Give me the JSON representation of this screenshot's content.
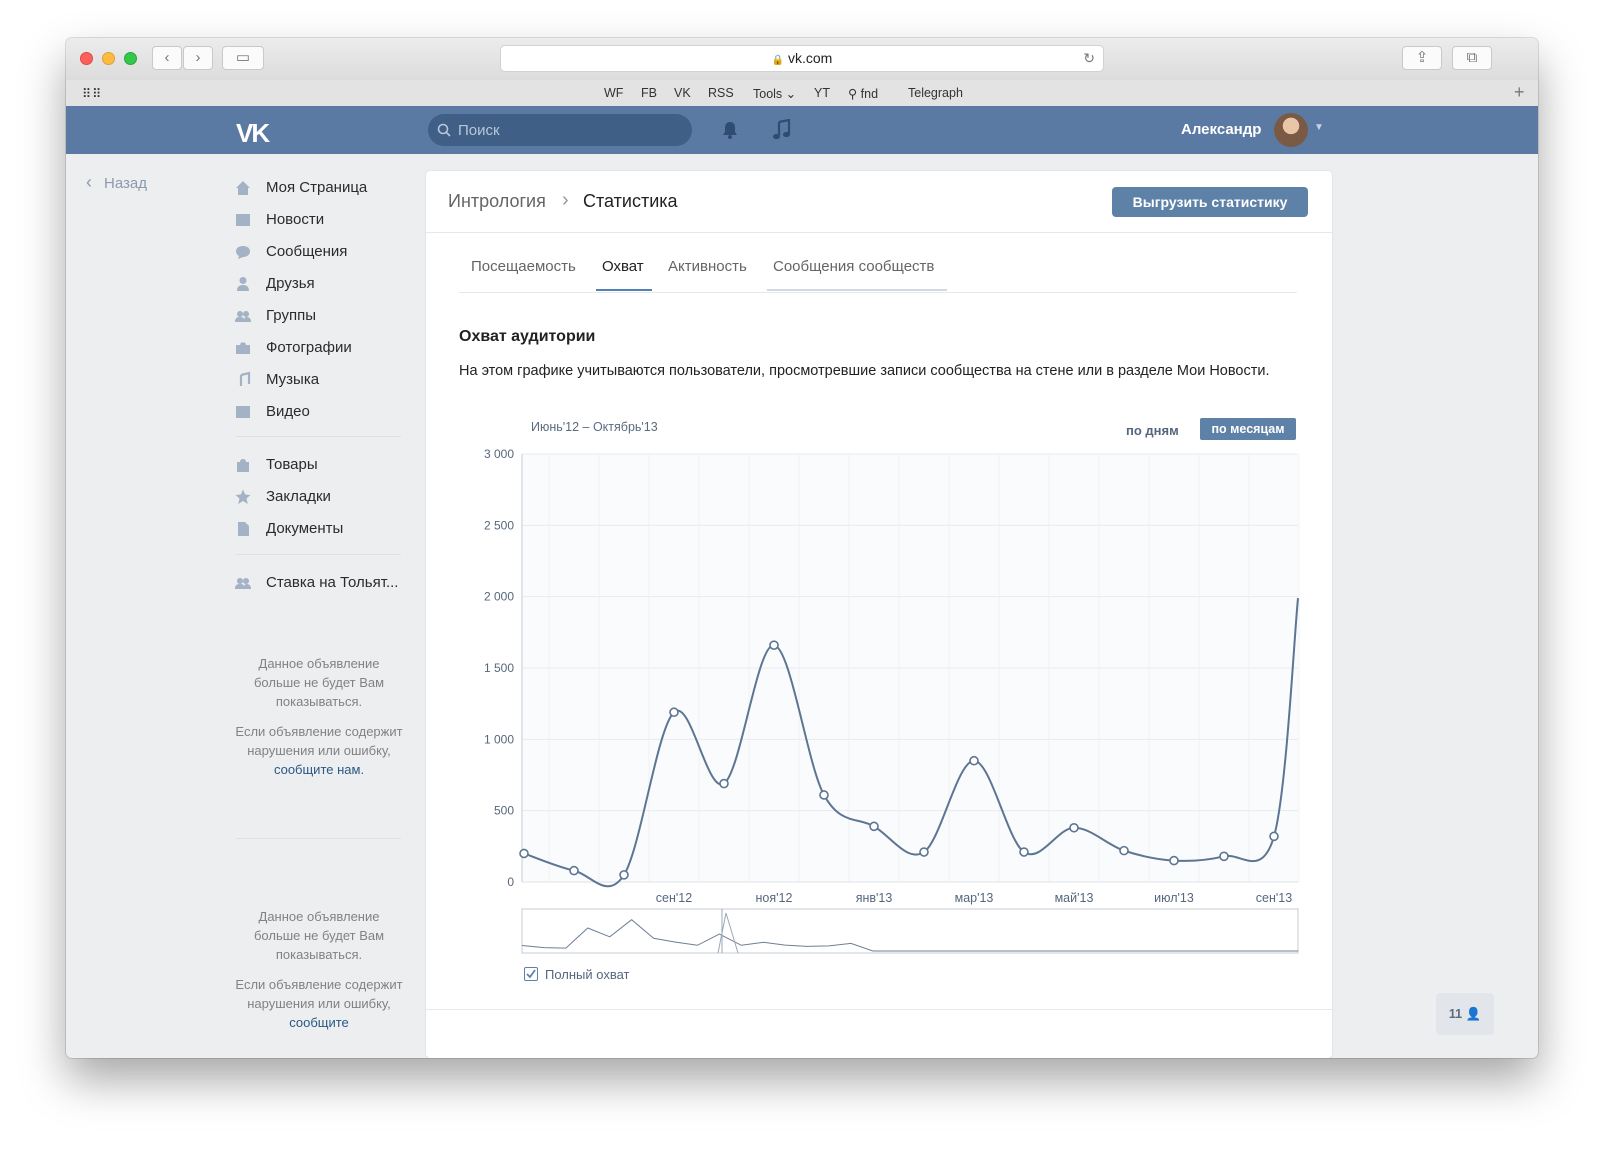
{
  "browser": {
    "url": "vk.com",
    "favorites": [
      "WF",
      "FB",
      "VK",
      "RSS",
      "Tools",
      "YT",
      "fnd",
      "Telegraph"
    ]
  },
  "header": {
    "logo": "VK",
    "search_placeholder": "Поиск",
    "user_name": "Александр"
  },
  "sidebar": {
    "back": "Назад",
    "items": [
      {
        "label": "Моя Страница",
        "icon": "home-icon"
      },
      {
        "label": "Новости",
        "icon": "news-icon"
      },
      {
        "label": "Сообщения",
        "icon": "messages-icon"
      },
      {
        "label": "Друзья",
        "icon": "friend-icon"
      },
      {
        "label": "Группы",
        "icon": "groups-icon"
      },
      {
        "label": "Фотографии",
        "icon": "camera-icon"
      },
      {
        "label": "Музыка",
        "icon": "music-icon"
      },
      {
        "label": "Видео",
        "icon": "video-icon"
      },
      {
        "label": "Товары",
        "icon": "bag-icon"
      },
      {
        "label": "Закладки",
        "icon": "star-icon"
      },
      {
        "label": "Документы",
        "icon": "document-icon"
      },
      {
        "label": "Ставка на Тольят...",
        "icon": "groups-icon"
      }
    ],
    "ads": [
      {
        "line1": "Данное объявление больше не будет Вам показываться.",
        "line2": "Если объявление содержит нарушения или ошибку,",
        "link": "сообщите нам."
      },
      {
        "line1": "Данное объявление больше не будет Вам показываться.",
        "line2": "Если объявление содержит нарушения или ошибку,",
        "link": "сообщите"
      }
    ]
  },
  "page": {
    "breadcrumb_parent": "Интрология",
    "breadcrumb_current": "Статистика",
    "export_button": "Выгрузить статистику",
    "tabs": [
      "Посещаемость",
      "Охват",
      "Активность",
      "Сообщения сообществ"
    ],
    "active_tab": "Охват",
    "section_title": "Охват аудитории",
    "description": "На этом графике учитываются пользователи, просмотревшие записи сообщества на стене или в разделе Мои Новости.",
    "period": "Июнь'12 – Октябрь'13",
    "by_day": "по дням",
    "by_month": "по месяцам",
    "legend_label": "Полный охват",
    "online_counter": "11"
  },
  "colors": {
    "accent": "#5a7aa3",
    "line": "#5d7593",
    "button": "#5e81a8"
  },
  "chart_data": {
    "type": "line",
    "x": [
      "июн'12",
      "июл'12",
      "авг'12",
      "сен'12",
      "окт'12",
      "ноя'12",
      "дек'12",
      "янв'13",
      "фев'13",
      "мар'13",
      "апр'13",
      "май'13",
      "июн'13",
      "июл'13",
      "авг'13",
      "сен'13"
    ],
    "series": [
      {
        "values": [
          200,
          80,
          50,
          1190,
          690,
          1660,
          610,
          390,
          210,
          850,
          210,
          380,
          220,
          150,
          180,
          320
        ]
      }
    ],
    "last_partial_value": 1990,
    "x_tick_labels": [
      "сен'12",
      "ноя'12",
      "янв'13",
      "мар'13",
      "май'13",
      "июл'13",
      "сен'13"
    ],
    "y_ticks": [
      0,
      500,
      1000,
      1500,
      2000,
      2500,
      3000
    ],
    "y_tick_labels": [
      "0",
      "500",
      "1 000",
      "1 500",
      "2 000",
      "2 500",
      "3 000"
    ],
    "ylim": [
      0,
      3000
    ],
    "grid": true
  }
}
